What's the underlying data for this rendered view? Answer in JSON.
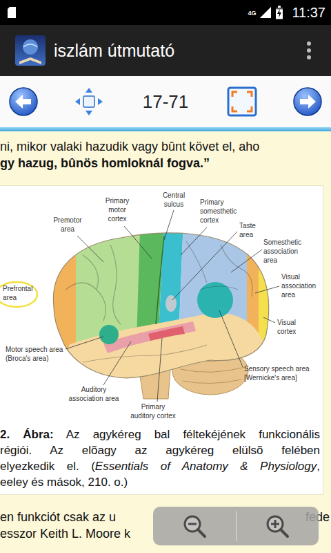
{
  "status_bar": {
    "network": "4G",
    "signal": {
      "level": 1
    },
    "battery": {
      "level": 0.9,
      "charging": true
    },
    "time": "11:37"
  },
  "app_bar": {
    "title": "iszlám útmutató"
  },
  "toolbar": {
    "page": "17-71"
  },
  "document": {
    "lines": [
      {
        "text": "ni, mikor valaki hazudik vagy bûnt követ el, aho",
        "bold": false
      },
      {
        "text": "gy hazug, bûnös homloknál fogva.”",
        "bold": true
      }
    ],
    "figure": {
      "labels": [
        {
          "lines": [
            "Premotor",
            "area"
          ]
        },
        {
          "lines": [
            "Primary",
            "motor",
            "cortex"
          ]
        },
        {
          "lines": [
            "Central",
            "sulcus"
          ]
        },
        {
          "lines": [
            "Primary",
            "somesthetic",
            "cortex"
          ]
        },
        {
          "lines": [
            "Taste",
            "area"
          ]
        },
        {
          "lines": [
            "Somesthetic",
            "association",
            "area"
          ]
        },
        {
          "lines": [
            "Prefrontal",
            "area"
          ]
        },
        {
          "lines": [
            "Visual",
            "association",
            "area"
          ]
        },
        {
          "lines": [
            "Visual",
            "cortex"
          ]
        },
        {
          "lines": [
            "Motor speech area",
            "(Broca's area)"
          ]
        },
        {
          "lines": [
            "Sensory speech area",
            "[Wernicke's area]"
          ]
        },
        {
          "lines": [
            "Auditory",
            "association area"
          ]
        },
        {
          "lines": [
            "Primary",
            "auditory cortex"
          ]
        }
      ]
    },
    "caption": [
      {
        "parts": [
          {
            "text": "2. Ábra:",
            "style": "bold"
          },
          {
            "text": " Az agykéreg bal féltekéjének funkcionális",
            "style": "normal"
          }
        ]
      },
      {
        "parts": [
          {
            "text": "régiói. Az elõagy az agykéreg elülsõ felében",
            "style": "normal"
          }
        ]
      },
      {
        "parts": [
          {
            "text": "elyezkedik el. (",
            "style": "normal"
          },
          {
            "text": "Essentials of Anatomy & Physiology",
            "style": "italic"
          },
          {
            "text": ",",
            "style": "normal"
          }
        ]
      },
      {
        "parts": [
          {
            "text": "eeley és mások, 210. o.)",
            "style": "normal"
          }
        ]
      }
    ],
    "after": [
      {
        "left": "en funkciót csak az u",
        "right": "fede"
      },
      {
        "left": "esszor Keith L. Moore k",
        "right": ""
      }
    ]
  }
}
